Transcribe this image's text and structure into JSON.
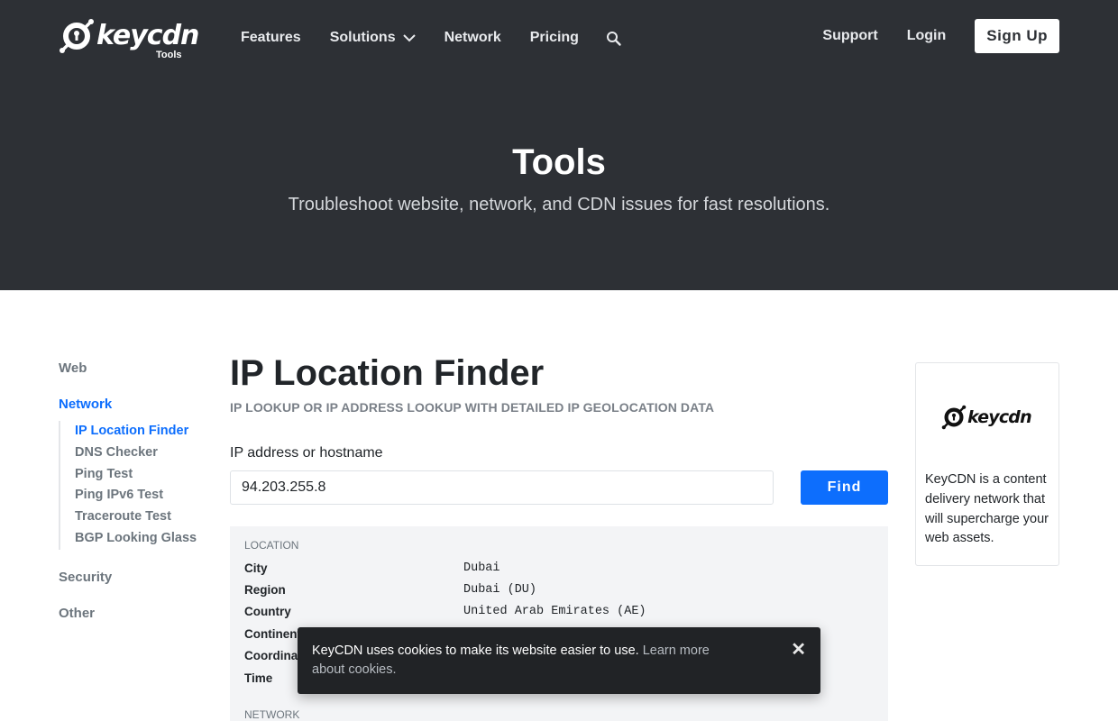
{
  "header": {
    "brand": "keycdn",
    "brand_sub": "Tools",
    "nav": [
      "Features",
      "Solutions",
      "Network",
      "Pricing"
    ],
    "support": "Support",
    "login": "Login",
    "signup": "Sign Up"
  },
  "hero": {
    "title": "Tools",
    "subtitle": "Troubleshoot website, network, and CDN issues for fast resolutions."
  },
  "sidebar": {
    "web": "Web",
    "network": "Network",
    "network_items": [
      "IP Location Finder",
      "DNS Checker",
      "Ping Test",
      "Ping IPv6 Test",
      "Traceroute Test",
      "BGP Looking Glass"
    ],
    "security": "Security",
    "other": "Other"
  },
  "main": {
    "title": "IP Location Finder",
    "subtitle": "IP LOOKUP OR IP ADDRESS LOOKUP WITH DETAILED IP GEOLOCATION DATA",
    "field_label": "IP address or hostname",
    "input_value": "94.203.255.8",
    "find_button": "Find"
  },
  "results": {
    "location_label": "LOCATION",
    "rows": [
      {
        "key": "City",
        "value": "Dubai"
      },
      {
        "key": "Region",
        "value": "Dubai (DU)"
      },
      {
        "key": "Country",
        "value": "United Arab Emirates (AE)"
      },
      {
        "key": "Continent",
        "value": ""
      },
      {
        "key": "Coordinates",
        "value": ""
      },
      {
        "key": "Time",
        "value": ""
      }
    ],
    "network_label": "NETWORK"
  },
  "ad": {
    "brand": "keycdn",
    "text": "KeyCDN is a content delivery network that will supercharge your web assets."
  },
  "cookie": {
    "text": "KeyCDN uses cookies to make its website easier to use. ",
    "link": "Learn more about cookies.",
    "close": "✕"
  },
  "colors": {
    "header_bg": "#2d3035",
    "accent": "#0d6efd",
    "results_bg": "#f3f4f6"
  }
}
